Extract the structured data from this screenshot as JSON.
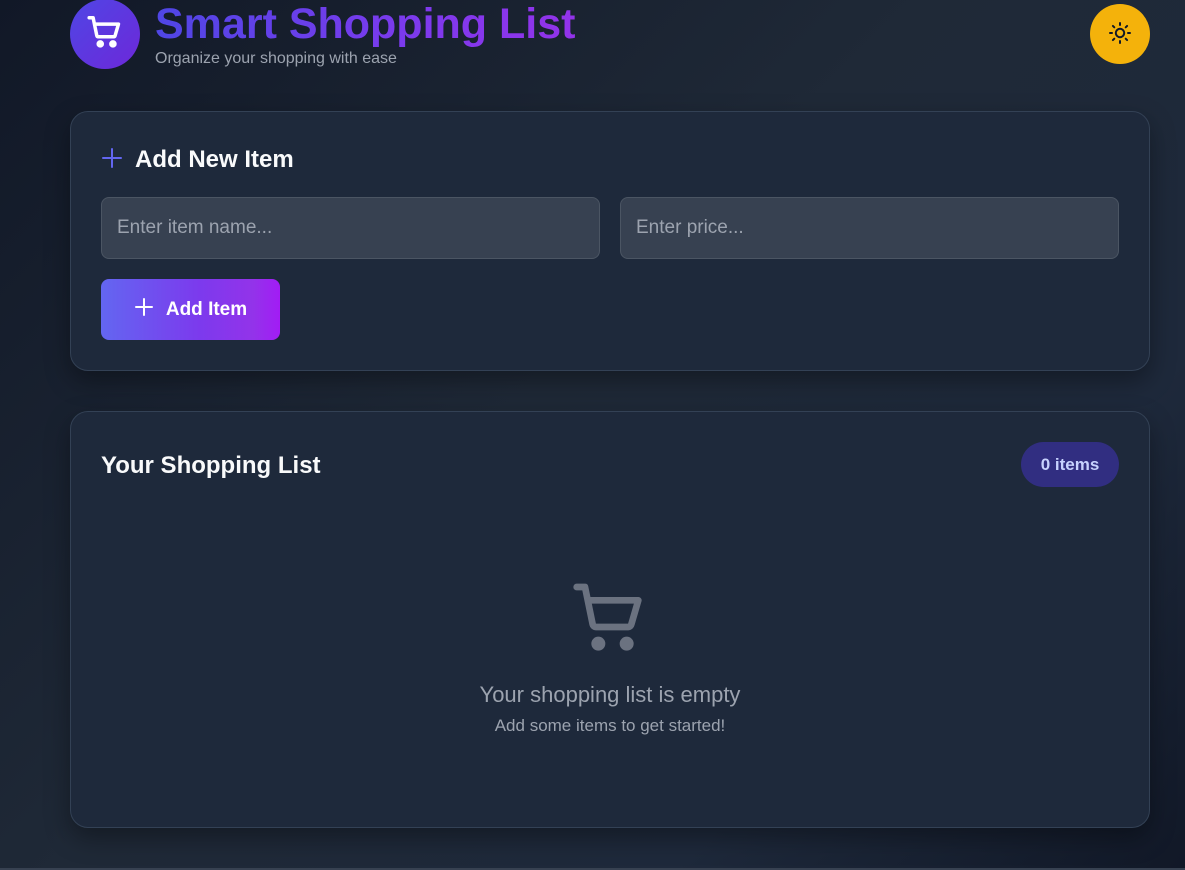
{
  "header": {
    "logo_icon": "shopping-cart-icon",
    "title": "Smart Shopping List",
    "subtitle": "Organize your shopping with ease",
    "theme_toggle_icon": "sun-icon"
  },
  "add_card": {
    "heading_icon": "plus-icon",
    "heading": "Add New Item",
    "name_placeholder": "Enter item name...",
    "name_value": "",
    "price_placeholder": "Enter price...",
    "price_value": "",
    "button_icon": "plus-icon",
    "button_label": "Add Item"
  },
  "list_card": {
    "title": "Your Shopping List",
    "count_badge": "0 items",
    "empty_icon": "shopping-cart-icon",
    "empty_title": "Your shopping list is empty",
    "empty_subtitle": "Add some items to get started!"
  },
  "colors": {
    "accent": "#6366f1",
    "accent_purple": "#9333ea",
    "toggle_bg": "#f4b20b",
    "card_bg": "#1e293b",
    "badge_bg": "#312e81"
  }
}
